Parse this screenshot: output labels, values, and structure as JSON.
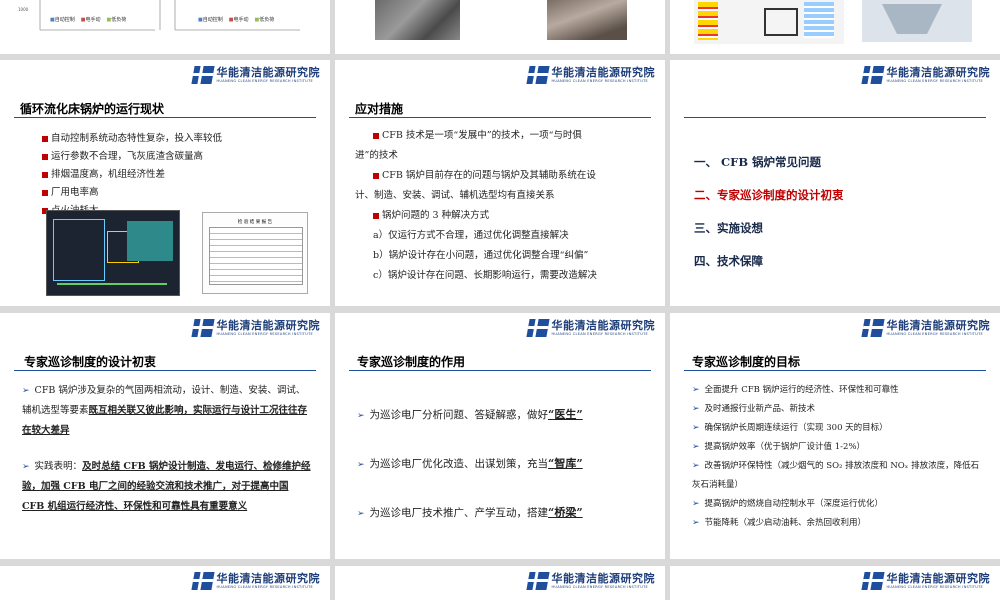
{
  "org": {
    "name_cn": "华能清洁能源研究院",
    "name_en": "HUANENG CLEAN ENERGY RESEARCH INSTITUTE"
  },
  "colors": {
    "brand": "#1f4e9c",
    "accent_red": "#c00000",
    "bg": "#d9d9d9"
  },
  "top_row": {
    "chart1_legend": [
      "自动控制",
      "电手动",
      "低负荷"
    ],
    "chart2_legend": [
      "自动控制",
      "电手动",
      "低负荷"
    ],
    "chart1_ytick": "1000"
  },
  "slide_status": {
    "title": "循环流化床锅炉的运行现状",
    "items": [
      "自动控制系统动态特性复杂，投入率较低",
      "运行参数不合理，飞灰底渣含碳量高",
      "排烟温度高，机组经济性差",
      "厂用电率高",
      "点火油耗大"
    ]
  },
  "slide_measures": {
    "title": "应对措施",
    "p1a": "CFB 技术是一项“发展中”的技术，一项“与时俱",
    "p1b": "进”的技术",
    "p2a": "CFB 锅炉目前存在的问题与锅炉及其辅助系统在设",
    "p2b": "计、制造、安装、调试、辅机选型均有直接关系",
    "p3": "锅炉问题的 3 种解决方式",
    "a": "a）仅运行方式不合理，通过优化调整直接解决",
    "b": "b）锅炉设计存在小问题，通过优化调整合理“纠偏”",
    "c": "c）锅炉设计存在问题、长期影响运行，需要改造解决"
  },
  "slide_toc": {
    "items": [
      "一、 CFB 锅炉常见问题",
      "二、专家巡诊制度的设计初衷",
      "三、实施设想",
      "四、技术保障"
    ]
  },
  "slide_intent": {
    "title": "专家巡诊制度的设计初衷",
    "p1_plain": "CFB 锅炉涉及复杂的气固两相流动，设计、制造、安装、调试、辅机选型等要素",
    "p1_bold": "既互相关联又彼此影响，实际运行与设计工况往往存在较大差异",
    "p2_plain": "实践表明：",
    "p2_bold": "及时总结 CFB 锅炉设计制造、发电运行、检修维护经验，加强 CFB 电厂之间的经验交流和技术推广，对于提高中国 CFB 机组运行经济性、环保性和可靠性具有重要意义"
  },
  "slide_role": {
    "title": "专家巡诊制度的作用",
    "items": [
      {
        "text": "为巡诊电厂分析问题、答疑解惑，做好",
        "key": "“医生”"
      },
      {
        "text": "为巡诊电厂优化改造、出谋划策，充当",
        "key": "“智库”"
      },
      {
        "text": "为巡诊电厂技术推广、产学互动，搭建",
        "key": "“桥梁”"
      }
    ]
  },
  "slide_goals": {
    "title": "专家巡诊制度的目标",
    "items": [
      "全面提升 CFB 锅炉运行的经济性、环保性和可靠性",
      "及时通报行业新产品、新技术",
      "确保锅炉长周期连续运行（实现 300 天的目标）",
      "提高锅炉效率（优于锅炉厂设计值 1-2%）",
      "改善锅炉环保特性（减少烟气的 SO₂ 排放浓度和 NOₓ 排放浓度，降低石灰石消耗量）",
      "提高锅炉的燃烧自动控制水平（深度运行优化）",
      "节能降耗（减少启动油耗、余热回收利用）"
    ]
  },
  "table_thumb": {
    "title": "检 验 结 果 报 告"
  }
}
